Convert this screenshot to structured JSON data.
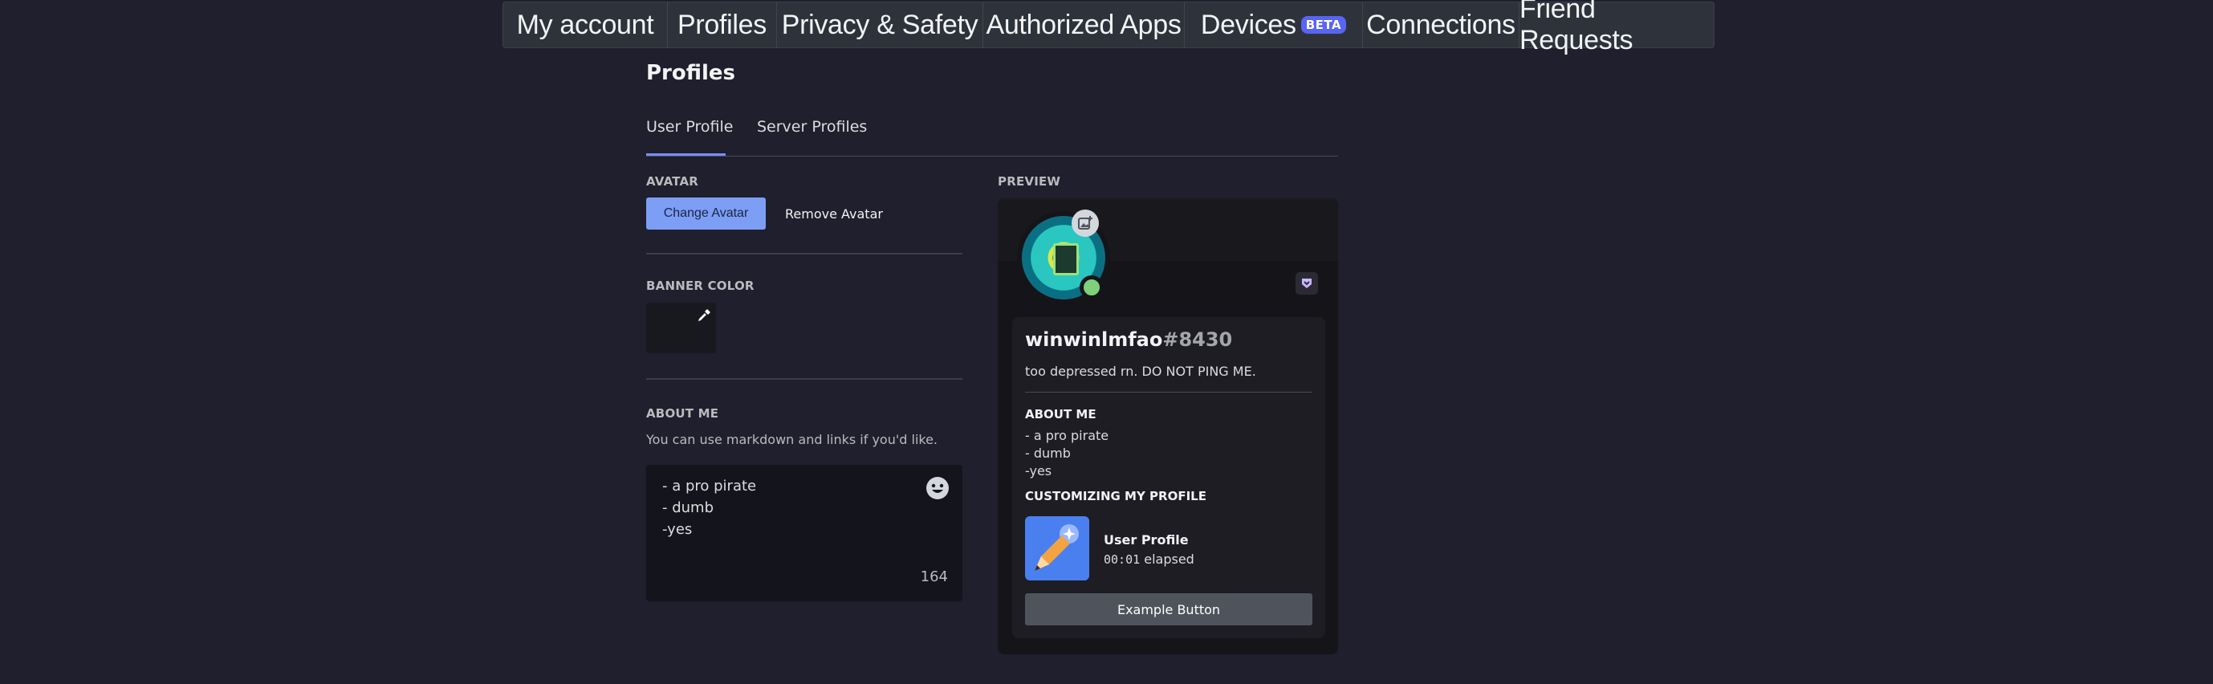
{
  "top_tabs": [
    {
      "label": "My account"
    },
    {
      "label": "Profiles"
    },
    {
      "label": "Privacy & Safety"
    },
    {
      "label": "Authorized Apps"
    },
    {
      "label": "Devices",
      "badge": "BETA"
    },
    {
      "label": "Connections"
    },
    {
      "label": "Friend Requests"
    }
  ],
  "page": {
    "title": "Profiles",
    "subtabs": [
      {
        "label": "User Profile",
        "active": true
      },
      {
        "label": "Server Profiles",
        "active": false
      }
    ]
  },
  "avatar_section": {
    "label": "AVATAR",
    "change_button": "Change Avatar",
    "remove_button": "Remove Avatar"
  },
  "banner_section": {
    "label": "BANNER COLOR",
    "color": "#18181f"
  },
  "about_section": {
    "label": "ABOUT ME",
    "hint": "You can use markdown and links if you'd like.",
    "lines": [
      "- a pro pirate",
      "- dumb",
      "-yes"
    ],
    "remaining": "164"
  },
  "preview": {
    "label": "PREVIEW",
    "username": "winwinlmfao",
    "discriminator": "#8430",
    "custom_status": "too depressed rn. DO NOT PING ME.",
    "about_label": "ABOUT ME",
    "about_lines": [
      "- a pro pirate",
      "- dumb",
      "-yes"
    ],
    "activity_label": "CUSTOMIZING MY PROFILE",
    "activity_title": "User Profile",
    "activity_time": "00:01",
    "activity_suffix": "elapsed",
    "example_button": "Example Button"
  },
  "colors": {
    "accent": "#7d9ef5",
    "online": "#7fd07a",
    "beta": "#5865f2"
  }
}
